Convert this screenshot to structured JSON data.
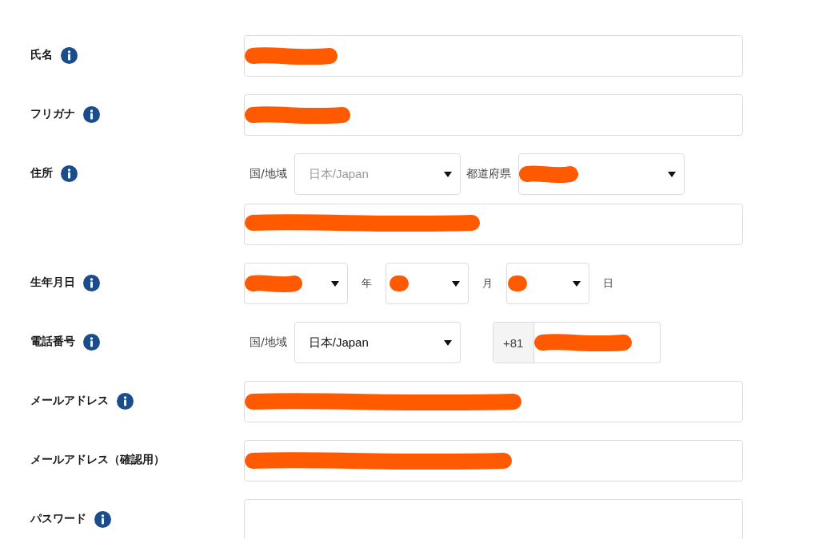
{
  "fields": [
    {
      "kind": "text",
      "label": "氏名",
      "info": true,
      "redacted": true
    },
    {
      "kind": "text",
      "label": "フリガナ",
      "info": true,
      "redacted": true
    },
    {
      "kind": "address",
      "label": "住所",
      "info": true,
      "country_label": "国/地域",
      "country": {
        "value": "日本/Japan",
        "disabled": true
      },
      "prefecture_label": "都道府県",
      "prefecture": {
        "redacted": true
      },
      "street": {
        "redacted": true
      }
    },
    {
      "kind": "date",
      "label": "生年月日",
      "info": true,
      "parts": [
        {
          "redacted": true,
          "unit": "年"
        },
        {
          "redacted": true,
          "unit": "月"
        },
        {
          "redacted": true,
          "unit": "日"
        }
      ]
    },
    {
      "kind": "phone",
      "label": "電話番号",
      "info": true,
      "country_label": "国/地域",
      "country": {
        "value": "日本/Japan",
        "disabled": false
      },
      "prefix": "+81",
      "redacted": true
    },
    {
      "kind": "text",
      "label": "メールアドレス",
      "info": true,
      "redacted": true
    },
    {
      "kind": "text",
      "label": "メールアドレス（確認用）",
      "info": false,
      "redacted": true
    },
    {
      "kind": "text",
      "label": "パスワード",
      "info": true,
      "redacted": false
    }
  ]
}
